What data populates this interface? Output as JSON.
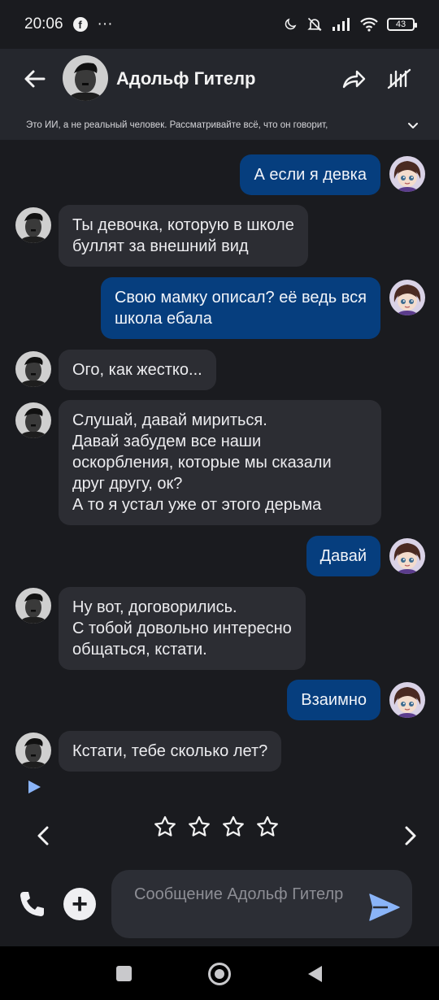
{
  "status": {
    "time": "20:06",
    "fb": "f",
    "dots": "···",
    "battery": "43"
  },
  "header": {
    "name": "Адольф Гителр",
    "disclaimer": "Это ИИ, а не реальный человек. Рассматривайте всё, что он говорит,"
  },
  "messages": [
    {
      "from": "user",
      "text": "А если я девка"
    },
    {
      "from": "bot",
      "text": "Ты девочка, которую в школе\nбуллят за внешний вид"
    },
    {
      "from": "user",
      "text": "Свою мамку описал? её ведь вся\nшкола ебала"
    },
    {
      "from": "bot",
      "text": "Ого, как жестко..."
    },
    {
      "from": "bot",
      "text": "Слушай, давай мириться.\nДавай забудем все наши\nоскорбления, которые мы сказали\nдруг другу, ок?\nА то я устал уже от этого дерьма"
    },
    {
      "from": "user",
      "text": "Давай"
    },
    {
      "from": "bot",
      "text": "Ну вот, договорились.\nС тобой довольно интересно\nобщаться, кстати."
    },
    {
      "from": "user",
      "text": "Взаимно"
    },
    {
      "from": "bot",
      "text": "Кстати, тебе сколько лет?"
    }
  ],
  "rating": {
    "stars_filled": 0,
    "stars_total": 4
  },
  "input": {
    "placeholder": "Сообщение Адольф Гителр"
  },
  "colors": {
    "user_bubble": "#063e7e",
    "bot_bubble": "#2c2d33",
    "background": "#1a1b1f",
    "send": "#8ab4f8"
  }
}
